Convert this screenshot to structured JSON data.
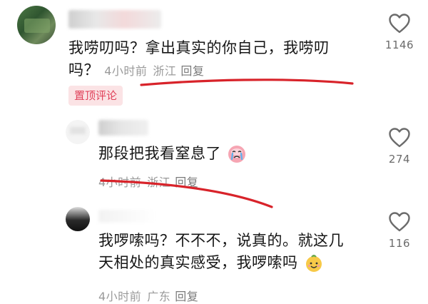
{
  "comments": [
    {
      "text_line1": "我唠叨吗？拿出真实的你自己，我唠叨",
      "text_line2": "吗？",
      "time": "4小时前",
      "location": "浙江",
      "reply": "回复",
      "likes": "1146",
      "badge": "置顶评论"
    },
    {
      "text_line1": "那段把我看窒息了",
      "time": "4小时前",
      "location": "浙江",
      "reply": "回复",
      "likes": "274",
      "emoji": "crying-face-emoji"
    },
    {
      "text_line1": "我啰嗦吗？不不不，说真的。就这几",
      "text_line2": "天相处的真实感受，我啰嗦吗",
      "time": "4小时前",
      "location": "广东",
      "reply": "回复",
      "likes": "116",
      "emoji": "smiling-face-emoji"
    }
  ],
  "colors": {
    "pin_badge_bg": "#fbe3e5",
    "pin_badge_text": "#e0425a",
    "annotation_red": "#d8232a"
  }
}
